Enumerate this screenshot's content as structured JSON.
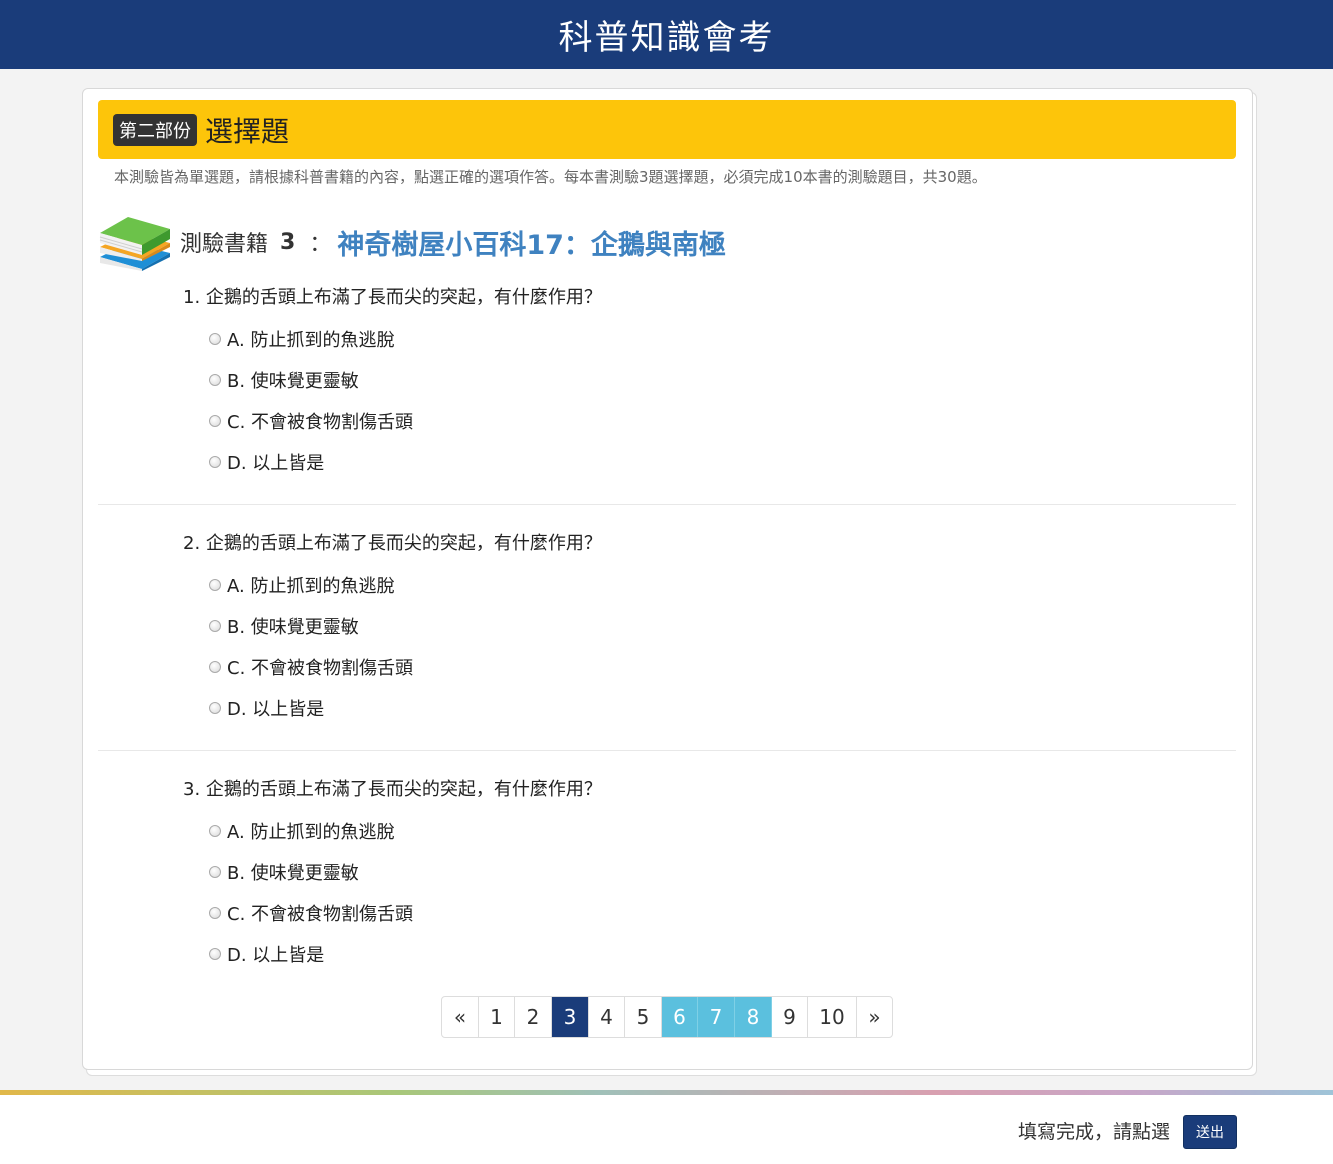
{
  "header": {
    "title": "科普知識會考"
  },
  "section": {
    "badge": "第二部份",
    "title": "選擇題"
  },
  "instructions": "本測驗皆為單選題，請根據科普書籍的內容，點選正確的選項作答。每本書測驗3題選擇題，必須完成10本書的測驗題目，共30題。",
  "book": {
    "label": "測驗書籍",
    "number": "3",
    "colon": "：",
    "title": "神奇樹屋小百科17：企鵝與南極"
  },
  "questions": [
    {
      "text": "1. 企鵝的舌頭上布滿了長而尖的突起，有什麼作用？",
      "options": [
        "A. 防止抓到的魚逃脫",
        "B. 使味覺更靈敏",
        "C. 不會被食物割傷舌頭",
        "D. 以上皆是"
      ]
    },
    {
      "text": "2. 企鵝的舌頭上布滿了長而尖的突起，有什麼作用？",
      "options": [
        "A. 防止抓到的魚逃脫",
        "B. 使味覺更靈敏",
        "C. 不會被食物割傷舌頭",
        "D. 以上皆是"
      ]
    },
    {
      "text": "3. 企鵝的舌頭上布滿了長而尖的突起，有什麼作用？",
      "options": [
        "A. 防止抓到的魚逃脫",
        "B. 使味覺更靈敏",
        "C. 不會被食物割傷舌頭",
        "D. 以上皆是"
      ]
    }
  ],
  "pagination": {
    "prev": "«",
    "next": "»",
    "pages": [
      "1",
      "2",
      "3",
      "4",
      "5",
      "6",
      "7",
      "8",
      "9",
      "10"
    ],
    "current": "3",
    "highlighted": [
      "6",
      "7",
      "8"
    ]
  },
  "footer": {
    "prompt": "填寫完成，請點選",
    "submit_label": "送出"
  },
  "colors": {
    "header_bg": "#1a3c7a",
    "section_bg": "#fdc50a",
    "book_title": "#3f82c0",
    "page_highlight": "#5bc0de"
  }
}
